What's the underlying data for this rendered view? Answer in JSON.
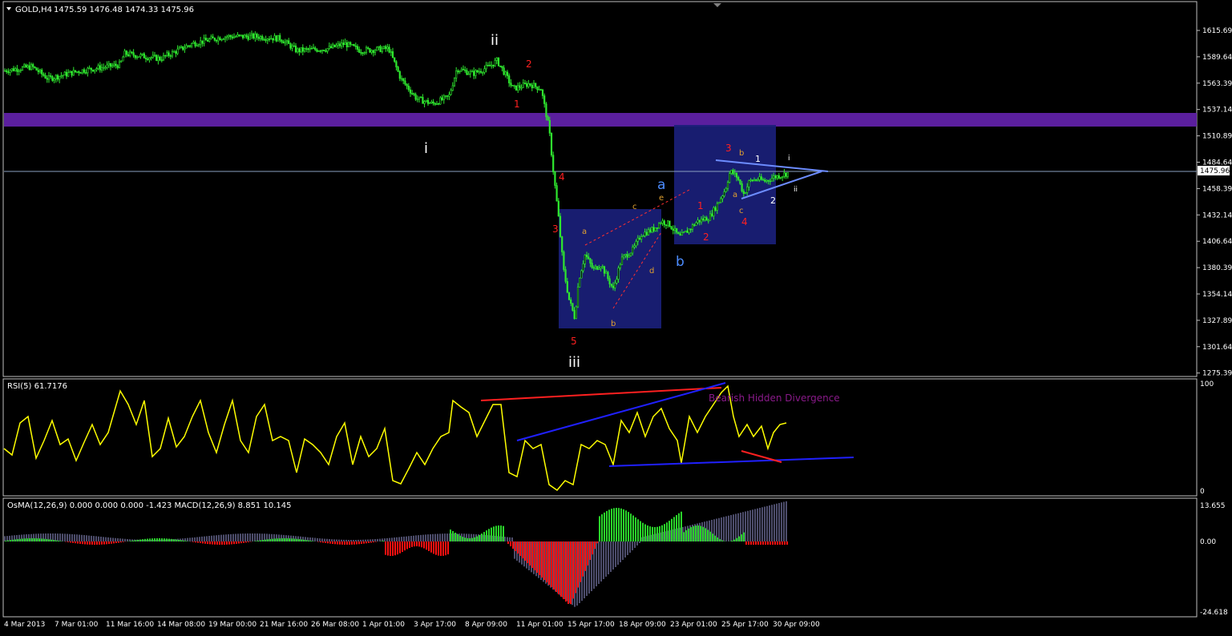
{
  "header": {
    "symbol_tf": "GOLD,H4",
    "ohlc": "1475.59 1476.48 1474.33 1475.96"
  },
  "current_price_label": "1475.96",
  "price_axis": [
    "1615.69",
    "1589.64",
    "1563.39",
    "1537.14",
    "1510.89",
    "1484.64",
    "1458.39",
    "1432.14",
    "1406.64",
    "1380.39",
    "1354.14",
    "1327.89",
    "1301.64",
    "1275.39"
  ],
  "time_axis": [
    "4 Mar 2013",
    "7 Mar 01:00",
    "11 Mar 16:00",
    "14 Mar 08:00",
    "19 Mar 00:00",
    "21 Mar 16:00",
    "26 Mar 08:00",
    "1 Apr 01:00",
    "3 Apr 17:00",
    "8 Apr 09:00",
    "11 Apr 01:00",
    "15 Apr 17:00",
    "18 Apr 09:00",
    "23 Apr 01:00",
    "25 Apr 17:00",
    "30 Apr 09:00"
  ],
  "rsi": {
    "title": "RSI(5) 61.7176",
    "axis_top": "100",
    "axis_bottom": "0",
    "annotation": "Bearish Hidden Divergence"
  },
  "macd": {
    "title": "OsMA(12,26,9) 0.000 0.000 0.000 -1.423  MACD(12,26,9) 8.851 10.145",
    "axis_top": "13.655",
    "axis_mid": "0.00",
    "axis_bottom": "-24.618"
  },
  "wave_labels": {
    "i_main": "i",
    "ii_main": "ii",
    "iii_main": "iii",
    "one_red": "1",
    "two_red": "2",
    "three_red": "3",
    "four_red": "4",
    "five_red": "5",
    "a_blue": "a",
    "b_blue": "b",
    "a_orange": "a",
    "b_orange": "b",
    "c_orange": "c",
    "d_orange": "d",
    "e_orange": "e",
    "one_red_b": "1",
    "two_red_b": "2",
    "three_red_b": "3",
    "four_red_b": "4",
    "tri_a": "a",
    "tri_b": "b",
    "tri_c": "c",
    "tri_1": "1",
    "tri_2": "2",
    "tri_i": "i",
    "tri_ii": "ii"
  },
  "colors": {
    "candles": "#2fe82f",
    "resistance_band": "#5b1f9e",
    "box": "#1a1f7a",
    "rsi_line": "#ffff00",
    "divergence_red": "#ff2020",
    "divergence_blue": "#2020ff",
    "hist_green": "#2ad42a",
    "hist_red": "#ff1010",
    "macd_lines": "#9a9ad8",
    "annotation": "#8a1a8a"
  },
  "chart_data": {
    "type": "candlestick",
    "title": "GOLD,H4",
    "ylim": [
      1275.39,
      1627
    ],
    "x": [
      "4 Mar 2013",
      "7 Mar 01:00",
      "11 Mar 16:00",
      "14 Mar 08:00",
      "19 Mar 00:00",
      "21 Mar 16:00",
      "26 Mar 08:00",
      "1 Apr 01:00",
      "3 Apr 17:00",
      "8 Apr 09:00",
      "11 Apr 01:00",
      "15 Apr 17:00",
      "18 Apr 09:00",
      "23 Apr 01:00",
      "25 Apr 17:00",
      "30 Apr 09:00"
    ],
    "close": [
      1578,
      1580,
      1585,
      1590,
      1605,
      1608,
      1603,
      1597,
      1555,
      1577,
      1558,
      1345,
      1395,
      1420,
      1470,
      1476
    ],
    "last_close": 1475.96,
    "resistance_zone": [
      1524,
      1537
    ]
  }
}
